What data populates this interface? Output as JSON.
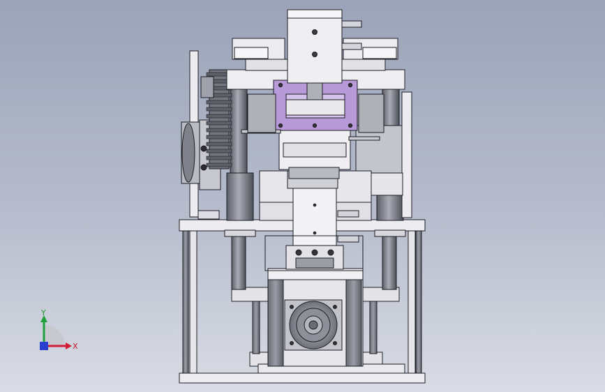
{
  "viewport": {
    "background_top": "#9aa3b8",
    "background_bottom": "#d9dce4"
  },
  "model": {
    "colors": {
      "frame": "#e9e9ee",
      "edge": "#1c1c24",
      "steel": "#8b8e99",
      "steel_dark": "#5f626b",
      "highlight": "#b79ad8",
      "gear": "#70737a"
    }
  },
  "triad": {
    "x_label": "X",
    "y_label": "Y",
    "x_color": "#d01c34",
    "y_color": "#20a03a",
    "z_color": "#2a3fd0",
    "icon": "coordinate-triad-icon"
  }
}
